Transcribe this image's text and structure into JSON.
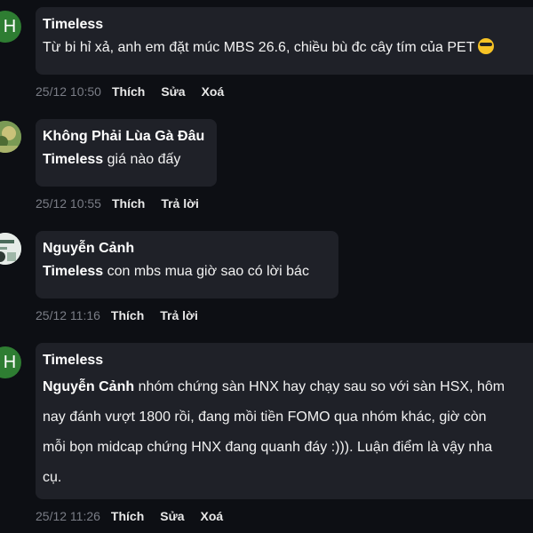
{
  "comments": [
    {
      "avatar_letter": "H",
      "author": "Timeless",
      "text": "Từ bi hỉ xả, anh em đặt múc MBS 26.6, chiều bù đc cây tím của PET",
      "time": "25/12 10:50",
      "actions": [
        "Thích",
        "Sửa",
        "Xoá"
      ],
      "emoji_icon": "sunglasses-emoji-icon"
    },
    {
      "author": "Không Phải Lùa Gà Đâu",
      "mention": "Timeless",
      "text": " giá nào đấy",
      "time": "25/12 10:55",
      "actions": [
        "Thích",
        "Trả lời"
      ]
    },
    {
      "author": "Nguyễn Cảnh",
      "mention": "Timeless",
      "text": " con mbs mua giờ sao có lời bác",
      "time": "25/12 11:16",
      "actions": [
        "Thích",
        "Trả lời"
      ]
    },
    {
      "avatar_letter": "H",
      "author": "Timeless",
      "mention": "Nguyễn Cảnh",
      "lines": [
        " nhóm chứng sàn HNX hay chạy sau so với sàn HSX, hôm",
        "nay đánh vượt 1800 rồi, đang mồi tiền FOMO qua nhóm khác, giờ còn",
        "mỗi bọn midcap chứng HNX đang quanh đáy :))). Luận điểm là vậy nha",
        "cụ."
      ],
      "time": "25/12 11:26",
      "actions": [
        "Thích",
        "Sửa",
        "Xoá"
      ]
    }
  ]
}
